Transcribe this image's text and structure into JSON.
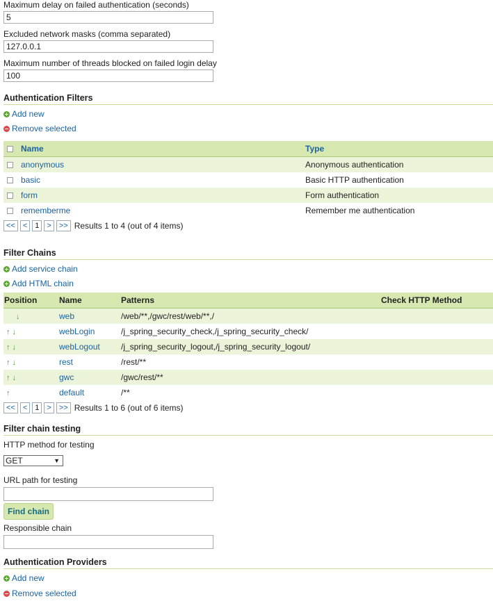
{
  "brute_force": {
    "max_delay_label": "Maximum delay on failed authentication (seconds)",
    "max_delay_value": "5",
    "excluded_masks_label": "Excluded network masks (comma separated)",
    "excluded_masks_value": "127.0.0.1",
    "max_threads_label": "Maximum number of threads blocked on failed login delay",
    "max_threads_value": "100"
  },
  "auth_filters": {
    "title": "Authentication Filters",
    "add_new": "Add new",
    "remove_selected": "Remove selected",
    "columns": {
      "name": "Name",
      "type": "Type"
    },
    "rows": [
      {
        "name": "anonymous",
        "type": "Anonymous authentication"
      },
      {
        "name": "basic",
        "type": "Basic HTTP authentication"
      },
      {
        "name": "form",
        "type": "Form authentication"
      },
      {
        "name": "rememberme",
        "type": "Remember me authentication"
      }
    ],
    "pager": {
      "first": "<<",
      "prev": "<",
      "page": "1",
      "next": ">",
      "last": ">>",
      "results": "Results 1 to 4 (out of 4 items)"
    }
  },
  "filter_chains": {
    "title": "Filter Chains",
    "add_service_chain": "Add service chain",
    "add_html_chain": "Add HTML chain",
    "columns": {
      "position": "Position",
      "name": "Name",
      "patterns": "Patterns",
      "check_http": "Check HTTP Method"
    },
    "rows": [
      {
        "arrows": "↓",
        "name": "web",
        "patterns": "/web/**,/gwc/rest/web/**,/"
      },
      {
        "arrows": "↑ ↓",
        "name": "webLogin",
        "patterns": "/j_spring_security_check,/j_spring_security_check/"
      },
      {
        "arrows": "↑ ↓",
        "name": "webLogout",
        "patterns": "/j_spring_security_logout,/j_spring_security_logout/"
      },
      {
        "arrows": "↑ ↓",
        "name": "rest",
        "patterns": "/rest/**"
      },
      {
        "arrows": "↑ ↓",
        "name": "gwc",
        "patterns": "/gwc/rest/**"
      },
      {
        "arrows": "↑",
        "name": "default",
        "patterns": "/**"
      }
    ],
    "pager": {
      "first": "<<",
      "prev": "<",
      "page": "1",
      "next": ">",
      "last": ">>",
      "results": "Results 1 to 6 (out of 6 items)"
    }
  },
  "chain_testing": {
    "title": "Filter chain testing",
    "method_label": "HTTP method for testing",
    "method_value": "GET",
    "url_label": "URL path for testing",
    "url_value": "",
    "find_button": "Find chain",
    "responsible_label": "Responsible chain",
    "responsible_value": ""
  },
  "auth_providers": {
    "title": "Authentication Providers",
    "add_new": "Add new",
    "remove_selected": "Remove selected"
  },
  "colors": {
    "link": "#1a62a3",
    "header_bg": "#d6e8b0",
    "row_alt_bg": "#ebf4d9",
    "add_icon": "#5aa832",
    "remove_icon": "#d94b4b"
  }
}
